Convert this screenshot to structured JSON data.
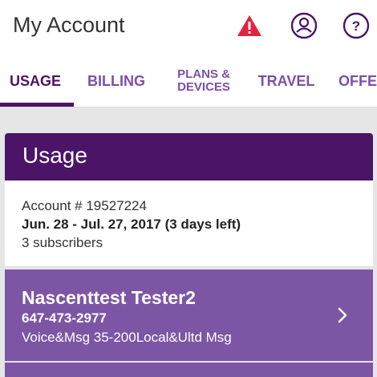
{
  "header": {
    "title": "My Account",
    "icons": [
      "alert-icon",
      "profile-icon",
      "help-icon"
    ],
    "alert_color": "#e2233f",
    "brand_color": "#4b1467"
  },
  "tabs": [
    {
      "label": "USAGE",
      "active": true
    },
    {
      "label": "BILLING",
      "active": false
    },
    {
      "label": "PLANS & DEVICES",
      "active": false
    },
    {
      "label": "TRAVEL",
      "active": false
    },
    {
      "label": "OFFE",
      "active": false
    }
  ],
  "usage": {
    "title": "Usage",
    "account_number": "Account # 19527224",
    "billing_period": "Jun. 28 - Jul. 27, 2017 (3 days left)",
    "subscribers": "3 subscribers"
  },
  "subscriber": {
    "name": "Nascenttest Tester2",
    "phone": "647-473-2977",
    "plan": "Voice&Msg 35-200Local&Ultd Msg",
    "card_color": "#7d55a5"
  }
}
